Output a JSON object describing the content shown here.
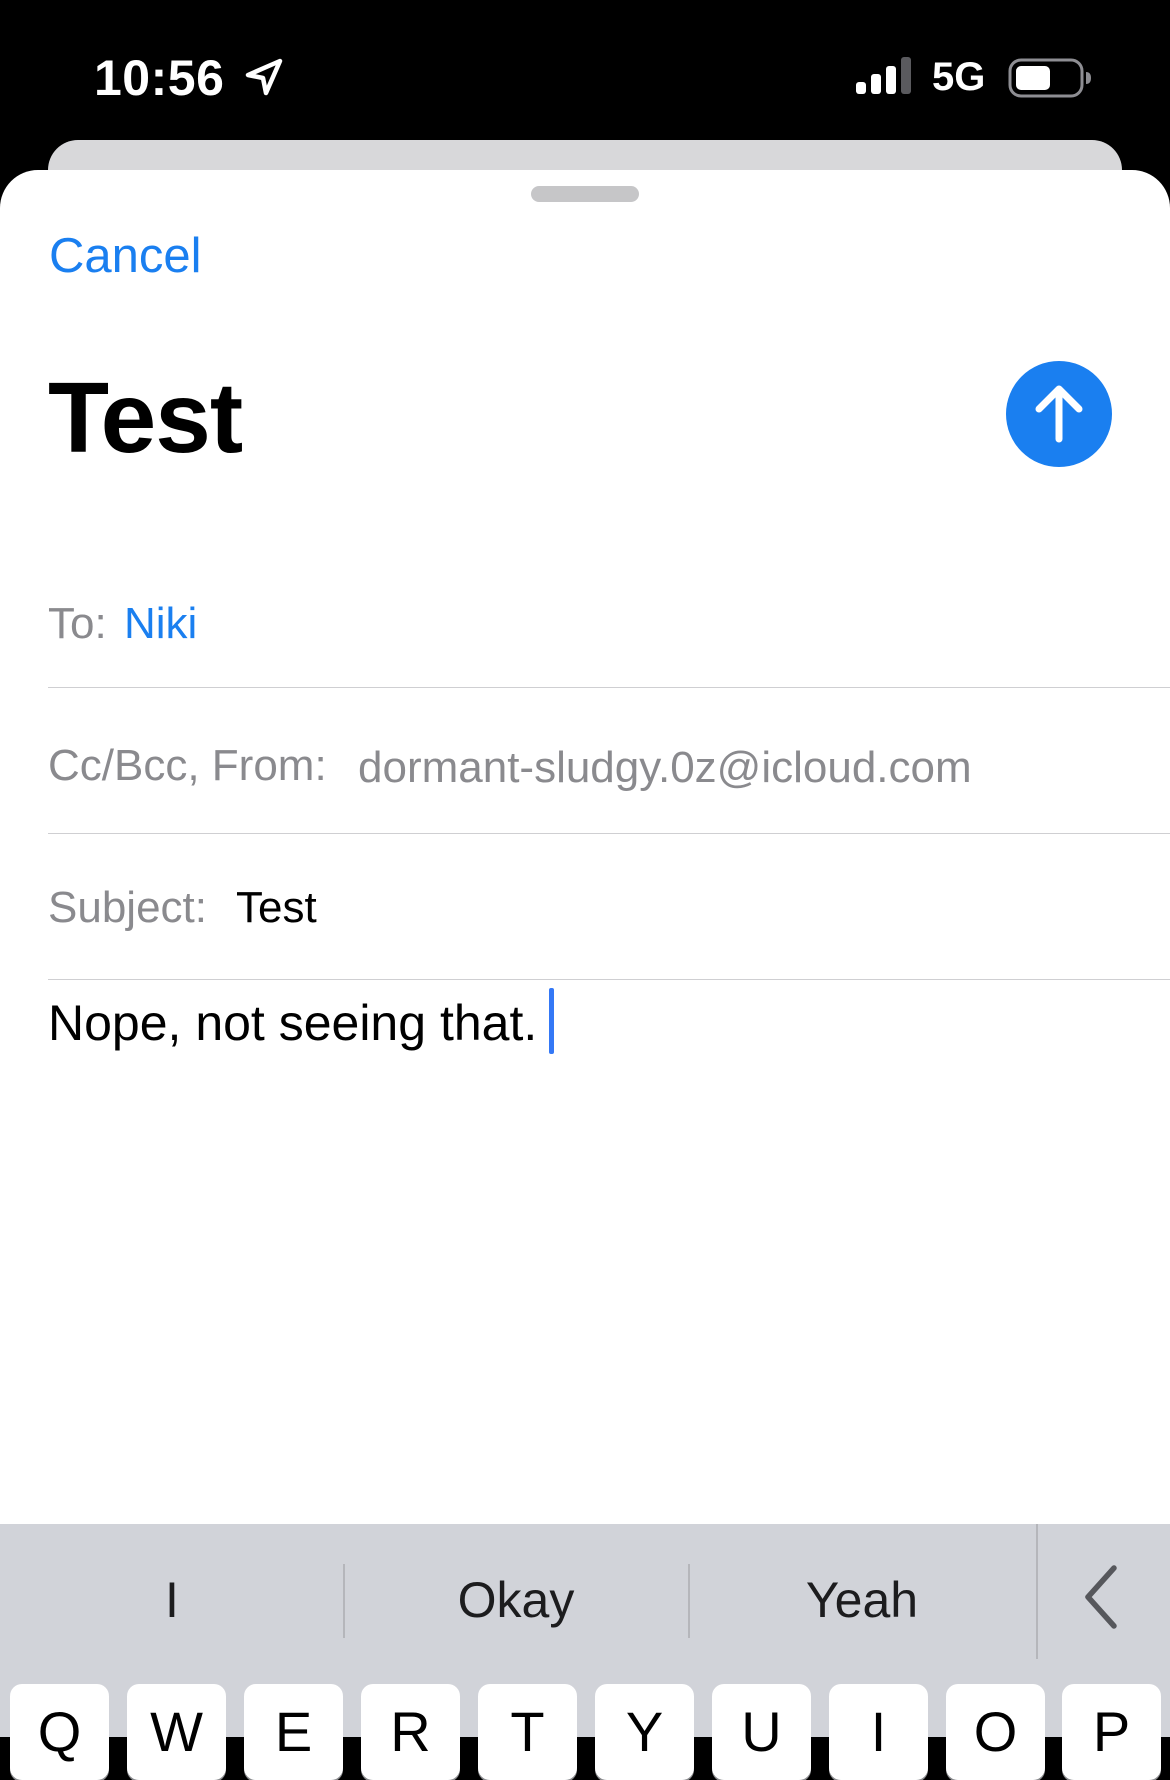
{
  "status_bar": {
    "time": "10:56",
    "network": "5G"
  },
  "compose": {
    "cancel_label": "Cancel",
    "title": "Test",
    "to_label": "To:",
    "to_value": "Niki",
    "from_label": "Cc/Bcc, From:",
    "from_value": "dormant-sludgy.0z@icloud.com",
    "subject_label": "Subject:",
    "subject_value": "Test",
    "body_text": "Nope, not seeing that."
  },
  "keyboard": {
    "suggestions": [
      "I",
      "Okay",
      "Yeah"
    ],
    "top_row_keys": [
      "Q",
      "W",
      "E",
      "R",
      "T",
      "Y",
      "U",
      "I",
      "O",
      "P"
    ]
  },
  "colors": {
    "accent": "#1a7ff0",
    "secondary_text": "#8a8a8e",
    "caret": "#3478f6",
    "keyboard_bg": "#d1d3d9"
  },
  "icons": {
    "location": "location-arrow-icon",
    "signal": "cellular-signal-icon",
    "battery": "battery-icon",
    "send": "arrow-up-icon",
    "collapse": "chevron-left-icon"
  }
}
